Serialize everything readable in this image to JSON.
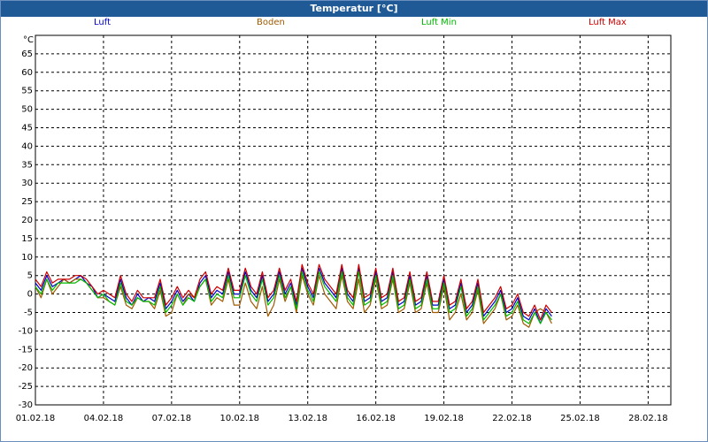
{
  "window": {
    "title": "Temperatur [°C]"
  },
  "chart_data": {
    "type": "line",
    "title": "Temperatur [°C]",
    "ylabel": "°C",
    "xlabel": "",
    "ylim": [
      -30,
      70
    ],
    "xlim": [
      0,
      28
    ],
    "grid": true,
    "legend_position": "top",
    "y_ticks": [
      "-30",
      "-25",
      "-20",
      "-15",
      "-10",
      "-5",
      "0",
      "5",
      "10",
      "15",
      "20",
      "25",
      "30",
      "35",
      "40",
      "45",
      "50",
      "55",
      "60",
      "65"
    ],
    "x_ticks": [
      {
        "x": 0,
        "label": "01.02.18"
      },
      {
        "x": 3,
        "label": "04.02.18"
      },
      {
        "x": 6,
        "label": "07.02.18"
      },
      {
        "x": 9,
        "label": "10.02.18"
      },
      {
        "x": 12,
        "label": "13.02.18"
      },
      {
        "x": 15,
        "label": "16.02.18"
      },
      {
        "x": 18,
        "label": "19.02.18"
      },
      {
        "x": 21,
        "label": "22.02.18"
      },
      {
        "x": 24,
        "label": "25.02.18"
      },
      {
        "x": 27,
        "label": "28.02.18"
      }
    ],
    "x": [
      0,
      0.25,
      0.5,
      0.75,
      1,
      1.25,
      1.5,
      1.75,
      2,
      2.25,
      2.5,
      2.75,
      3,
      3.25,
      3.5,
      3.75,
      4,
      4.25,
      4.5,
      4.75,
      5,
      5.25,
      5.5,
      5.75,
      6,
      6.25,
      6.5,
      6.75,
      7,
      7.25,
      7.5,
      7.75,
      8,
      8.25,
      8.5,
      8.75,
      9,
      9.25,
      9.5,
      9.75,
      10,
      10.25,
      10.5,
      10.75,
      11,
      11.25,
      11.5,
      11.75,
      12,
      12.25,
      12.5,
      12.75,
      13,
      13.25,
      13.5,
      13.75,
      14,
      14.25,
      14.5,
      14.75,
      15,
      15.25,
      15.5,
      15.75,
      16,
      16.25,
      16.5,
      16.75,
      17,
      17.25,
      17.5,
      17.75,
      18,
      18.25,
      18.5,
      18.75,
      19,
      19.25,
      19.5,
      19.75,
      20,
      20.25,
      20.5,
      20.75,
      21,
      21.25,
      21.5,
      21.75,
      22,
      22.25,
      22.5,
      22.75,
      23,
      23.25,
      23.5,
      23.75,
      24,
      24.25,
      24.5,
      24.75,
      25,
      25.25,
      25.5,
      25.75,
      26,
      26.25,
      26.5,
      26.75,
      27,
      27.25,
      27.5,
      27.75,
      28
    ],
    "series": [
      {
        "name": "Luft",
        "color": "#0000cc",
        "values": [
          3,
          1,
          5,
          2,
          3,
          4,
          3,
          4,
          5,
          3,
          2,
          -1,
          0,
          -1,
          -2,
          4,
          -1,
          -3,
          0,
          -2,
          -1,
          -2,
          3,
          -4,
          -2,
          1,
          -2,
          0,
          -2,
          3,
          5,
          -1,
          1,
          0,
          6,
          0,
          0,
          6,
          1,
          -1,
          5,
          -2,
          0,
          6,
          0,
          3,
          -3,
          7,
          2,
          -1,
          7,
          3,
          1,
          -1,
          7,
          0,
          -2,
          7,
          -2,
          -1,
          6,
          -2,
          -1,
          6,
          -3,
          -2,
          5,
          -3,
          -2,
          5,
          -3,
          -3,
          4,
          -4,
          -3,
          3,
          -5,
          -3,
          3,
          -6,
          -4,
          -2,
          1,
          -5,
          -4,
          -1,
          -6,
          -7,
          -4,
          -8,
          -4,
          -6
        ]
      },
      {
        "name": "Boden",
        "color": "#a05a00",
        "values": [
          2,
          -1,
          4,
          0,
          2,
          4,
          3,
          4,
          4,
          3,
          1,
          -1,
          -1,
          -2,
          -3,
          2,
          -3,
          -4,
          -1,
          -2,
          -2,
          -4,
          1,
          -6,
          -5,
          0,
          -3,
          0,
          -1,
          2,
          4,
          -3,
          -1,
          -2,
          4,
          -3,
          -3,
          3,
          -2,
          -4,
          2,
          -6,
          -3,
          4,
          -2,
          2,
          -5,
          5,
          0,
          -3,
          5,
          0,
          -2,
          -4,
          5,
          -2,
          -4,
          4,
          -5,
          -3,
          4,
          -4,
          -3,
          4,
          -5,
          -4,
          3,
          -5,
          -4,
          3,
          -5,
          -5,
          2,
          -7,
          -5,
          0,
          -7,
          -5,
          1,
          -8,
          -6,
          -4,
          0,
          -7,
          -6,
          -3,
          -8,
          -9,
          -5,
          -4,
          -5,
          -8
        ]
      },
      {
        "name": "Luft Min",
        "color": "#00bb00",
        "values": [
          2,
          0,
          4,
          1,
          3,
          3,
          3,
          3,
          4,
          3,
          1,
          -1,
          0,
          -2,
          -3,
          3,
          -2,
          -3,
          -1,
          -2,
          -2,
          -3,
          2,
          -5,
          -3,
          0,
          -3,
          -1,
          -2,
          2,
          4,
          -2,
          0,
          -1,
          5,
          -1,
          -1,
          5,
          0,
          -2,
          4,
          -3,
          -1,
          5,
          -1,
          2,
          -4,
          6,
          1,
          -2,
          6,
          2,
          0,
          -2,
          6,
          -1,
          -3,
          6,
          -3,
          -2,
          5,
          -3,
          -2,
          5,
          -4,
          -3,
          4,
          -4,
          -3,
          4,
          -4,
          -4,
          3,
          -5,
          -4,
          2,
          -6,
          -4,
          2,
          -7,
          -5,
          -3,
          0,
          -6,
          -5,
          -2,
          -7,
          -8,
          -5,
          -8,
          -5,
          -7
        ]
      },
      {
        "name": "Luft Max",
        "color": "#cc0000",
        "values": [
          4,
          2,
          6,
          3,
          4,
          4,
          4,
          5,
          5,
          4,
          2,
          0,
          1,
          0,
          -1,
          5,
          0,
          -2,
          1,
          -1,
          -1,
          -1,
          4,
          -3,
          -1,
          2,
          -1,
          1,
          -1,
          4,
          6,
          0,
          2,
          1,
          7,
          1,
          1,
          7,
          2,
          0,
          6,
          -1,
          1,
          7,
          1,
          4,
          -2,
          8,
          3,
          0,
          8,
          4,
          2,
          0,
          8,
          1,
          -1,
          8,
          -1,
          0,
          7,
          -1,
          0,
          7,
          -2,
          -1,
          6,
          -2,
          -1,
          6,
          -2,
          -2,
          5,
          -3,
          -2,
          4,
          -4,
          -2,
          4,
          -5,
          -3,
          -1,
          2,
          -4,
          -3,
          0,
          -5,
          -6,
          -3,
          -7,
          -3,
          -5
        ]
      }
    ]
  }
}
